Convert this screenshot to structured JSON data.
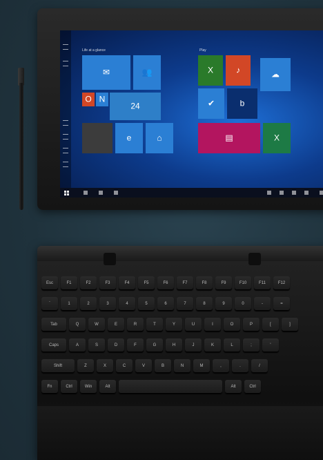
{
  "scene": {
    "background_color": "#22353f",
    "tablet": {
      "start_menu": {
        "group_left_title": "Life at a glance",
        "group_right_title": "Play",
        "tiles": [
          {
            "name": "tile-mail",
            "color": "#2b7fd4",
            "glyph": "✉"
          },
          {
            "name": "tile-people",
            "color": "#2b7fd4",
            "glyph": "👥"
          },
          {
            "name": "tile-office",
            "color": "#d24726",
            "glyph": "O"
          },
          {
            "name": "tile-onenote",
            "color": "#2b7fd4",
            "glyph": "N"
          },
          {
            "name": "tile-weather",
            "color": "#2e7fc8",
            "glyph": "24"
          },
          {
            "name": "tile-photos",
            "color": "#3c3c3c",
            "glyph": ""
          },
          {
            "name": "tile-edge",
            "color": "#2b7fd4",
            "glyph": "e"
          },
          {
            "name": "tile-store",
            "color": "#2b7fd4",
            "glyph": "⌂"
          },
          {
            "name": "tile-xbox",
            "color": "#2a7a2a",
            "glyph": "X"
          },
          {
            "name": "tile-groove",
            "color": "#d24726",
            "glyph": "♪"
          },
          {
            "name": "tile-check",
            "color": "#2b7fd4",
            "glyph": "✔"
          },
          {
            "name": "tile-bing",
            "color": "#0a2e6e",
            "glyph": "b"
          },
          {
            "name": "tile-onedrive",
            "color": "#2b7fd4",
            "glyph": "☁"
          },
          {
            "name": "tile-news",
            "color": "#b3155f",
            "glyph": "▤"
          },
          {
            "name": "tile-excel",
            "color": "#1d7a45",
            "glyph": "X"
          }
        ]
      }
    },
    "keyboard": {
      "rows": [
        [
          "Esc",
          "F1",
          "F2",
          "F3",
          "F4",
          "F5",
          "F6",
          "F7",
          "F8",
          "F9",
          "F10",
          "F11",
          "F12"
        ],
        [
          "`",
          "1",
          "2",
          "3",
          "4",
          "5",
          "6",
          "7",
          "8",
          "9",
          "0",
          "-",
          "="
        ],
        [
          "Tab",
          "Q",
          "W",
          "E",
          "R",
          "T",
          "Y",
          "U",
          "I",
          "O",
          "P",
          "[",
          "]"
        ],
        [
          "Caps",
          "A",
          "S",
          "D",
          "F",
          "G",
          "H",
          "J",
          "K",
          "L",
          ";",
          "'"
        ],
        [
          "Shift",
          "Z",
          "X",
          "C",
          "V",
          "B",
          "N",
          "M",
          ",",
          ".",
          "/"
        ],
        [
          "Fn",
          "Ctrl",
          "Win",
          "Alt",
          "",
          "Alt",
          "Ctrl"
        ]
      ]
    }
  }
}
